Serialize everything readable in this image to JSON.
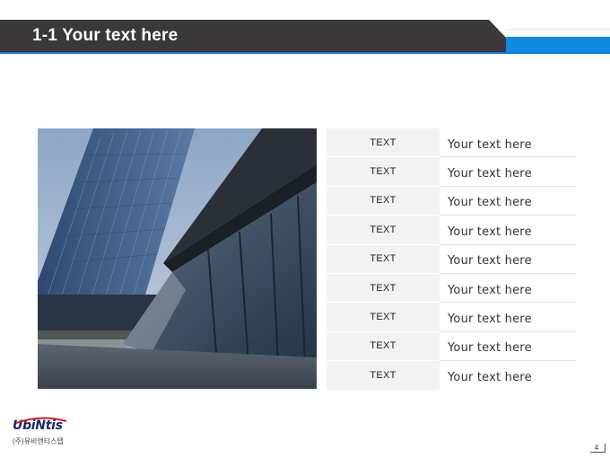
{
  "slide": {
    "title": "1-1 Your text here",
    "page_number": "4"
  },
  "colors": {
    "title_bar": "#3a3838",
    "accent_blue": "#0f8ae6",
    "table_key_bg": "#f2f2f2"
  },
  "table": {
    "rows": [
      {
        "key": "TEXT",
        "value": "Your text here"
      },
      {
        "key": "TEXT",
        "value": "Your text here"
      },
      {
        "key": "TEXT",
        "value": "Your text here"
      },
      {
        "key": "TEXT",
        "value": "Your text here"
      },
      {
        "key": "TEXT",
        "value": "Your text here"
      },
      {
        "key": "TEXT",
        "value": "Your text here"
      },
      {
        "key": "TEXT",
        "value": "Your text here"
      },
      {
        "key": "TEXT",
        "value": "Your text here"
      },
      {
        "key": "TEXT",
        "value": "Your text here"
      }
    ]
  },
  "logo": {
    "name": "UbiNtis",
    "subtitle": "(주)유비엔티스텝"
  },
  "photo": {
    "icon": "building-photo"
  }
}
